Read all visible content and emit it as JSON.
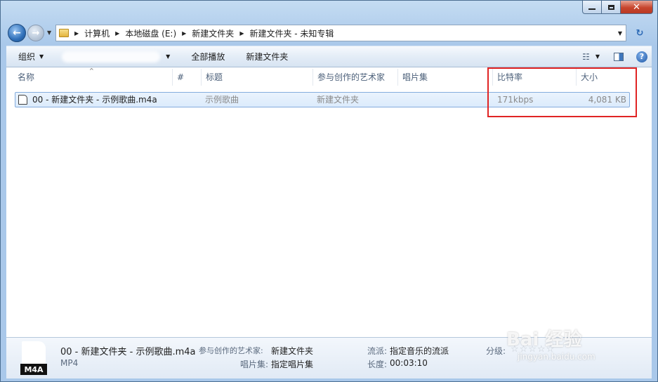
{
  "address": {
    "breadcrumbs": [
      "计算机",
      "本地磁盘 (E:)",
      "新建文件夹",
      "新建文件夹 - 未知专辑"
    ]
  },
  "toolbar": {
    "organize_label": "组织",
    "play_all_label": "全部播放",
    "new_folder_label": "新建文件夹"
  },
  "columns": [
    "名称",
    "#",
    "标题",
    "参与创作的艺术家",
    "唱片集",
    "比特率",
    "大小"
  ],
  "rows": [
    {
      "name": "00 - 新建文件夹 - 示例歌曲.m4a",
      "number": "",
      "title": "示例歌曲",
      "artist": "新建文件夹",
      "album": "",
      "bitrate": "171kbps",
      "size": "4,081 KB"
    }
  ],
  "details": {
    "thumb_label": "M4A",
    "filename": "00 - 新建文件夹 - 示例歌曲.m4a",
    "filetype": "MP4",
    "artist_label": "参与创作的艺术家:",
    "artist_value": "新建文件夹",
    "album_label": "唱片集:",
    "album_value": "指定唱片集",
    "genre_label": "流派:",
    "genre_value": "指定音乐的流派",
    "length_label": "长度:",
    "length_value": "00:03:10",
    "rating_label": "分级:",
    "rating_stars": "☆☆☆☆☆",
    "rating_value": 0
  },
  "watermark": {
    "main": "Bai  经验",
    "sub": "jingyan.baidu.com"
  },
  "colors": {
    "highlight": "#e02424",
    "selection": "#dcebfc"
  }
}
